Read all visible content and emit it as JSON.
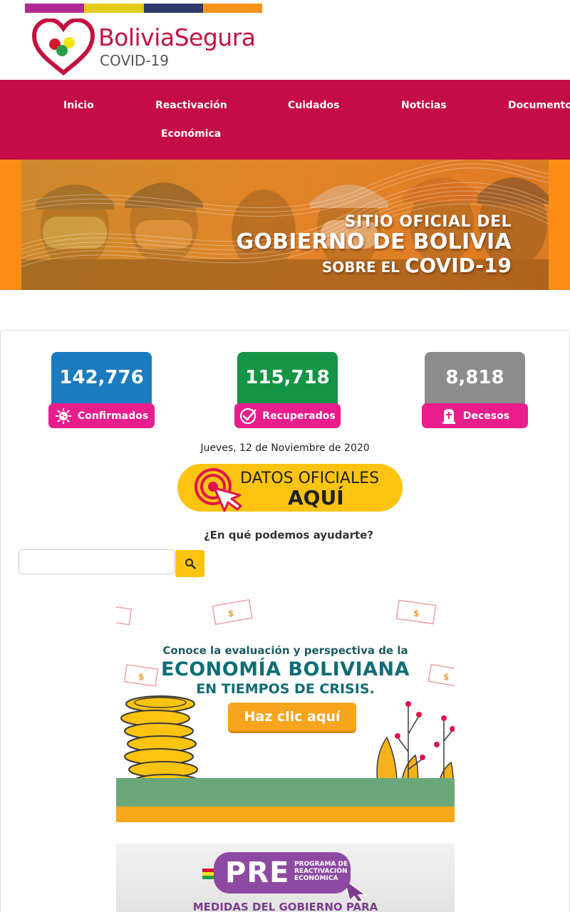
{
  "header": {
    "colorbar": [
      "#b02a96",
      "#e5cb18",
      "#2d3a6b",
      "#f7941d"
    ],
    "logo_title": "BoliviaSegura",
    "logo_subtitle": "COVID-19"
  },
  "nav": {
    "items": [
      {
        "label": "Inicio"
      },
      {
        "label": "Reactivación"
      },
      {
        "label": "Económica"
      },
      {
        "label": "Cuidados"
      },
      {
        "label": "Noticias"
      },
      {
        "label": "Documentos"
      }
    ]
  },
  "hero": {
    "line1": "SITIO OFICIAL DEL",
    "line2": "GOBIERNO DE BOLIVIA",
    "line3a": "SOBRE EL ",
    "line3b": "COVID-19"
  },
  "stats": [
    {
      "value": "142,776",
      "label": "Confirmados",
      "color": "#1a7bbf",
      "icon": "virus-icon"
    },
    {
      "value": "115,718",
      "label": "Recuperados",
      "color": "#139545",
      "icon": "check-circle-icon"
    },
    {
      "value": "8,818",
      "label": "Decesos",
      "color": "#8c8c8c",
      "icon": "tombstone-icon"
    }
  ],
  "date": "Jueves, 12 de Noviembre de 2020",
  "datos_button": {
    "line1": "DATOS OFICIALES",
    "line2": "AQUÍ",
    "icon": "cursor-target-icon"
  },
  "help_title": "¿En qué podemos ayudarte?",
  "search": {
    "placeholder": "",
    "icon": "search-icon"
  },
  "banner1": {
    "line1": "Conoce la evaluación y perspectiva de la",
    "line2": "ECONOMÍA BOLIVIANA",
    "line3": "EN TIEMPOS DE CRISIS.",
    "cta": "Haz clic aquí"
  },
  "banner2": {
    "word": "PRE",
    "small": "PROGRAMA DE\nREACTIVACIÓN\nECONÓMICA",
    "caption": "MEDIDAS DEL GOBIERNO PARA"
  }
}
